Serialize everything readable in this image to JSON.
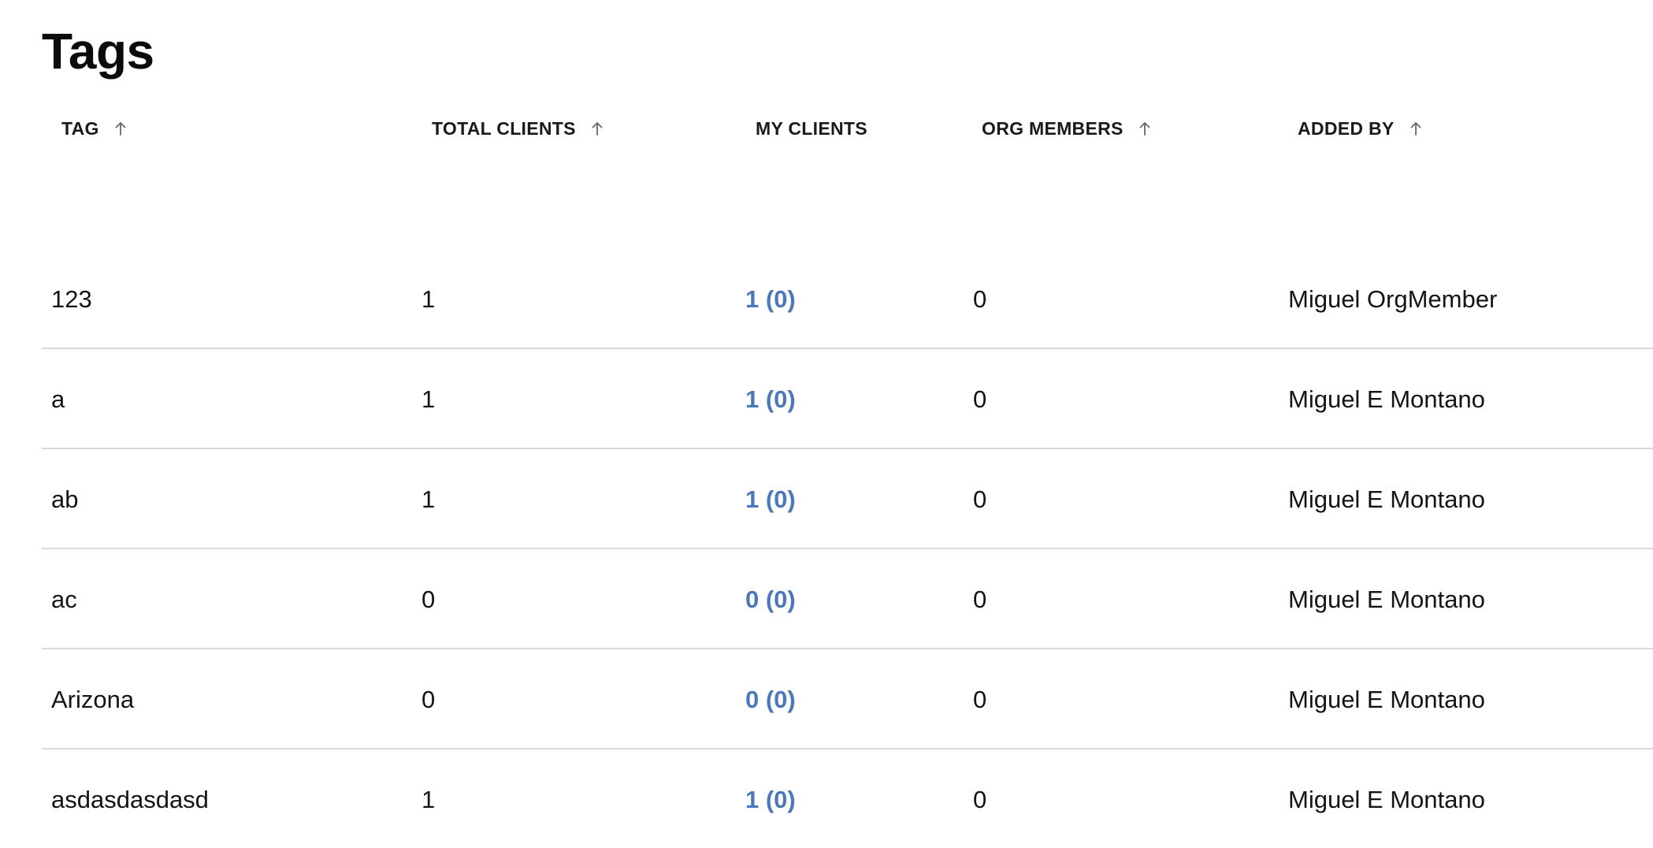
{
  "page": {
    "title": "Tags"
  },
  "table": {
    "columns": [
      {
        "key": "tag",
        "label": "TAG",
        "sortable": true,
        "sort_icon": "arrow-up-icon"
      },
      {
        "key": "total_clients",
        "label": "TOTAL CLIENTS",
        "sortable": true,
        "sort_icon": "arrow-up-icon"
      },
      {
        "key": "my_clients",
        "label": "MY CLIENTS",
        "sortable": false
      },
      {
        "key": "org_members",
        "label": "ORG MEMBERS",
        "sortable": true,
        "sort_icon": "arrow-up-icon"
      },
      {
        "key": "added_by",
        "label": "ADDED BY",
        "sortable": true,
        "sort_icon": "arrow-up-icon"
      }
    ],
    "rows": [
      {
        "tag": "123",
        "total_clients": "1",
        "my_clients": "1 (0)",
        "org_members": "0",
        "added_by": "Miguel OrgMember"
      },
      {
        "tag": "a",
        "total_clients": "1",
        "my_clients": "1 (0)",
        "org_members": "0",
        "added_by": "Miguel E Montano"
      },
      {
        "tag": "ab",
        "total_clients": "1",
        "my_clients": "1 (0)",
        "org_members": "0",
        "added_by": "Miguel E Montano"
      },
      {
        "tag": "ac",
        "total_clients": "0",
        "my_clients": "0 (0)",
        "org_members": "0",
        "added_by": "Miguel E Montano"
      },
      {
        "tag": "Arizona",
        "total_clients": "0",
        "my_clients": "0 (0)",
        "org_members": "0",
        "added_by": "Miguel E Montano"
      },
      {
        "tag": "asdasdasdasd",
        "total_clients": "1",
        "my_clients": "1 (0)",
        "org_members": "0",
        "added_by": "Miguel E Montano"
      }
    ]
  },
  "colors": {
    "link": "#4a78c0",
    "divider": "#d9d9d9",
    "text": "#141414"
  }
}
